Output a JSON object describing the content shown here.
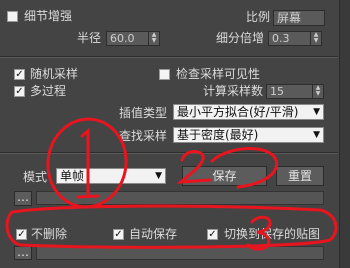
{
  "top": {
    "detail_enhance_label": "细节增强",
    "scale_label": "比例",
    "scale_value": "屏幕",
    "radius_label": "半径",
    "radius_value": "60.0",
    "subdiv_mult_label": "细分倍增",
    "subdiv_mult_value": "0.3"
  },
  "sampling": {
    "random_samples_label": "随机采样",
    "multipass_label": "多过程",
    "check_visibility_label": "检查采样可见性",
    "calc_pass_label": "计算采样数",
    "calc_pass_value": "15",
    "interp_type_label": "插值类型",
    "interp_type_value": "最小平方拟合(好/平滑)",
    "sample_lookup_label": "查找采样",
    "sample_lookup_value": "基于密度(最好)"
  },
  "mode": {
    "mode_label": "模式",
    "mode_value": "单帧",
    "save_button": "保存",
    "reset_button": "重置"
  },
  "bottom": {
    "dont_delete_label": "不删除",
    "auto_save_label": "自动保存",
    "switch_label": "切换到保存的贴图"
  },
  "annotations": {
    "circle_1": "1",
    "circle_2": "2",
    "circle_3": "3"
  },
  "colors": {
    "annotation": "#e8141e",
    "background": "#444444"
  }
}
